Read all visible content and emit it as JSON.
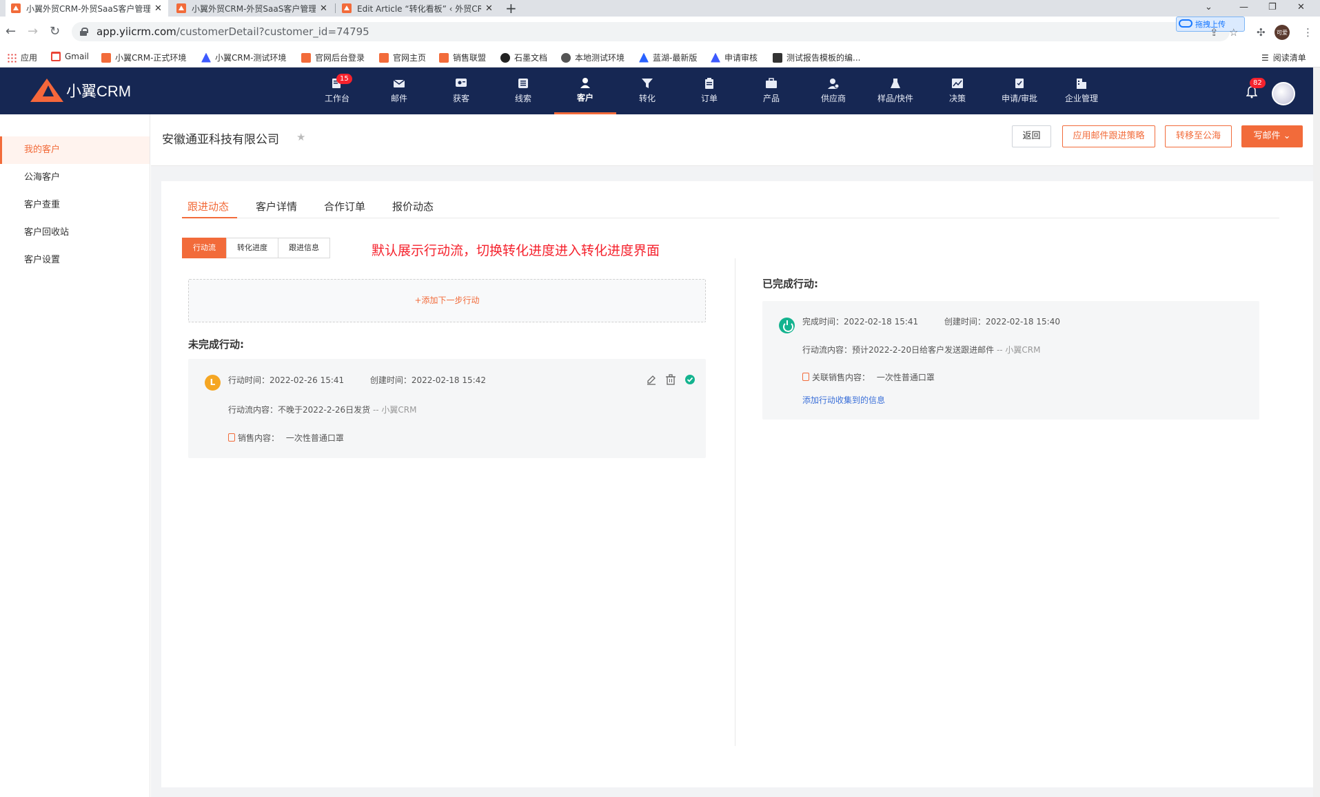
{
  "browser": {
    "tabs": [
      {
        "title": "小翼外贸CRM-外贸SaaS客户管理",
        "active": true
      },
      {
        "title": "小翼外贸CRM-外贸SaaS客户管理",
        "active": false
      },
      {
        "title": "Edit Article “转化看板” ‹ 外贸CR",
        "active": false
      }
    ],
    "url_host": "app.yiicrm.com",
    "url_path": "/customerDetail?customer_id=74795",
    "upload_label": "拖拽上传",
    "profile_label": "可爱",
    "bookmarks": [
      {
        "label": "应用",
        "icon": "apps-grid-icon"
      },
      {
        "label": "Gmail",
        "icon": "gmail-icon"
      },
      {
        "label": "小翼CRM-正式环境",
        "icon": "xiaoyi-icon"
      },
      {
        "label": "小翼CRM-测试环境",
        "icon": "triangle-icon"
      },
      {
        "label": "官网后台登录",
        "icon": "xiaoyi-icon"
      },
      {
        "label": "官网主页",
        "icon": "xiaoyi-icon"
      },
      {
        "label": "销售联盟",
        "icon": "xiaoyi-icon"
      },
      {
        "label": "石墨文档",
        "icon": "shimo-icon"
      },
      {
        "label": "本地测试环境",
        "icon": "globe-icon"
      },
      {
        "label": "蓝湖-最新版",
        "icon": "lanhu-icon"
      },
      {
        "label": "申请审核",
        "icon": "triangle-icon"
      },
      {
        "label": "测试报告模板的编...",
        "icon": "yuque-icon"
      }
    ],
    "reading_list": "阅读清单"
  },
  "app": {
    "logo_text": "小翼CRM",
    "nav": [
      {
        "label": "工作台",
        "icon": "workbench-icon",
        "badge": "15"
      },
      {
        "label": "邮件",
        "icon": "mail-icon"
      },
      {
        "label": "获客",
        "icon": "acquire-icon"
      },
      {
        "label": "线索",
        "icon": "leads-icon"
      },
      {
        "label": "客户",
        "icon": "customer-icon",
        "active": true
      },
      {
        "label": "转化",
        "icon": "funnel-icon"
      },
      {
        "label": "订单",
        "icon": "order-icon"
      },
      {
        "label": "产品",
        "icon": "product-icon"
      },
      {
        "label": "供应商",
        "icon": "supplier-icon"
      },
      {
        "label": "样品/快件",
        "icon": "sample-icon"
      },
      {
        "label": "决策",
        "icon": "decision-icon"
      },
      {
        "label": "申请/审批",
        "icon": "approval-icon"
      },
      {
        "label": "企业管理",
        "icon": "enterprise-icon"
      }
    ],
    "notification_count": "82"
  },
  "sidebar": {
    "items": [
      {
        "label": "我的客户",
        "active": true
      },
      {
        "label": "公海客户"
      },
      {
        "label": "客户查重"
      },
      {
        "label": "客户回收站"
      },
      {
        "label": "客户设置"
      }
    ]
  },
  "header": {
    "company": "安徽通亚科技有限公司",
    "back": "返回",
    "apply_strategy": "应用邮件跟进策略",
    "move_public": "转移至公海",
    "write_mail": "写邮件"
  },
  "detail_tabs": [
    "跟进动态",
    "客户详情",
    "合作订单",
    "报价动态"
  ],
  "segments": [
    "行动流",
    "转化进度",
    "跟进信息"
  ],
  "annotation": "默认展示行动流，切换转化进度进入转化进度界面",
  "add_action": "+添加下一步行动",
  "pending": {
    "title": "未完成行动:",
    "avatar_letter": "L",
    "action_time_label": "行动时间：",
    "action_time": "2022-02-26 15:41",
    "created_label": "创建时间：",
    "created": "2022-02-18 15:42",
    "content_label": "行动流内容：",
    "content": "不晚于2022-2-26日发货",
    "source": "-- 小翼CRM",
    "sales_label": "销售内容：",
    "sales_value": "一次性普通口罩"
  },
  "completed": {
    "title": "已完成行动:",
    "done_label": "完成时间：",
    "done_time": "2022-02-18 15:41",
    "created_label": "创建时间：",
    "created": "2022-02-18 15:40",
    "content_label": "行动流内容：",
    "content": "预计2022-2-20日给客户发送跟进邮件",
    "source": "-- 小翼CRM",
    "sales_label": "关联销售内容：",
    "sales_value": "一次性普通口罩",
    "collect_link": "添加行动收集到的信息"
  },
  "colors": {
    "brand": "#f26b3a",
    "header_bg": "#162753",
    "success": "#14b38f",
    "annotation": "#f5222d"
  }
}
